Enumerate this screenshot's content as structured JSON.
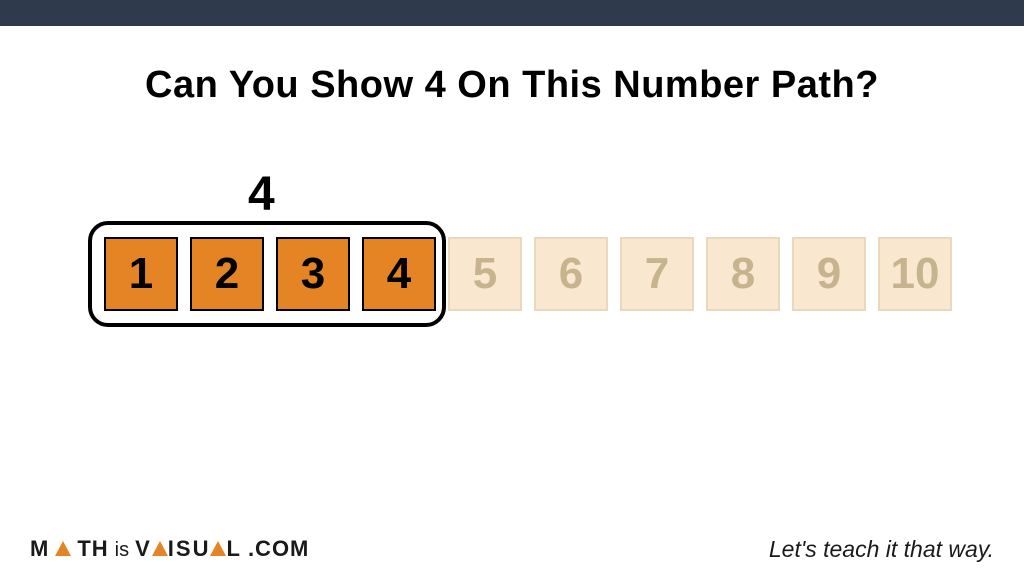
{
  "title": "Can You Show 4 On This Number Path?",
  "big_label": "4",
  "tiles": {
    "t1": "1",
    "t2": "2",
    "t3": "3",
    "t4": "4",
    "t5": "5",
    "t6": "6",
    "t7": "7",
    "t8": "8",
    "t9": "9",
    "t10": "10"
  },
  "highlighted_through": 4,
  "logo": {
    "m": "M",
    "th": "TH",
    "is": "is",
    "v": "V",
    "isu": "ISU",
    "l": "L",
    "dotcom": ".COM"
  },
  "tagline": "Let's teach it that way."
}
